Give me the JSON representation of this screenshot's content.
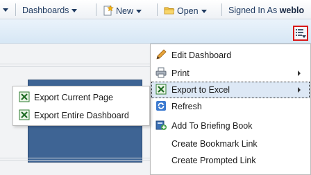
{
  "toolbar": {
    "items": [
      {
        "label": "Dashboards"
      },
      {
        "label": "New"
      },
      {
        "label": "Open"
      }
    ],
    "signed_in_prefix": "Signed In As",
    "signed_in_user": "weblo"
  },
  "page_options_icon": "page-options-menu-icon",
  "main_menu": {
    "items": [
      {
        "label": "Edit Dashboard",
        "icon": "pencil-icon"
      },
      {
        "label": "Print",
        "icon": "printer-icon",
        "has_submenu": true
      },
      {
        "label": "Export to Excel",
        "icon": "excel-icon",
        "has_submenu": true,
        "active": true
      },
      {
        "label": "Refresh",
        "icon": "refresh-icon"
      },
      {
        "label": "Add To Briefing Book",
        "icon": "add-briefing-book-icon"
      },
      {
        "label": "Create Bookmark Link"
      },
      {
        "label": "Create Prompted Link"
      }
    ]
  },
  "export_submenu": {
    "items": [
      {
        "label": "Export Current Page",
        "icon": "excel-icon"
      },
      {
        "label": "Export Entire Dashboard",
        "icon": "excel-icon"
      }
    ]
  },
  "colors": {
    "toolbar_text": "#1f3a60",
    "highlight_border": "#d81818",
    "dashboard_panel": "#3e6494",
    "menu_hover": "#dde8f5"
  }
}
